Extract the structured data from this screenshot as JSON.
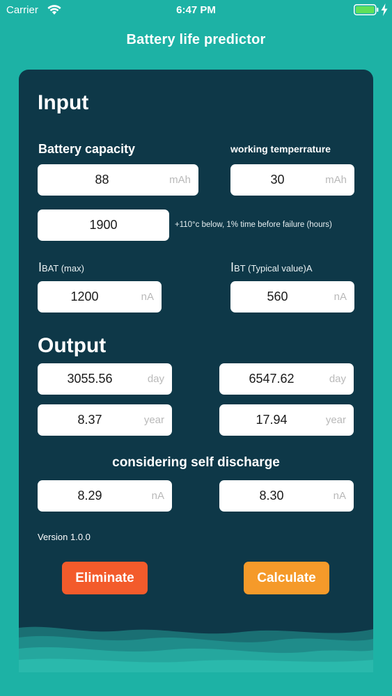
{
  "status_bar": {
    "carrier": "Carrier",
    "time": "6:47 PM"
  },
  "app": {
    "title": "Battery life predictor"
  },
  "input": {
    "heading": "Input",
    "battery_capacity_label": "Battery capacity",
    "working_temp_label": "working temperrature",
    "capacity": {
      "value": "88",
      "unit": "mAh"
    },
    "temperature": {
      "value": "30",
      "unit": "mAh"
    },
    "failure_hours": {
      "value": "1900",
      "note": "+110°c below, 1% time before failure (hours)"
    },
    "ibat_label": {
      "prefix": "I",
      "suffix": "BAT (max)"
    },
    "ibt_label": {
      "prefix": "I",
      "suffix": "BT (Typical value)A"
    },
    "ibat": {
      "value": "1200",
      "unit": "nA"
    },
    "ibt": {
      "value": "560",
      "unit": "nA"
    }
  },
  "output": {
    "heading": "Output",
    "days_left": {
      "value": "3055.56",
      "unit": "day"
    },
    "days_right": {
      "value": "6547.62",
      "unit": "day"
    },
    "years_left": {
      "value": "8.37",
      "unit": "year"
    },
    "years_right": {
      "value": "17.94",
      "unit": "year"
    },
    "self_discharge_label": "considering self discharge",
    "sd_left": {
      "value": "8.29",
      "unit": "nA"
    },
    "sd_right": {
      "value": "8.30",
      "unit": "nA"
    }
  },
  "version": "Version 1.0.0",
  "buttons": {
    "eliminate": "Eliminate",
    "calculate": "Calculate"
  },
  "colors": {
    "background": "#1db2a5",
    "card": "#0e3848",
    "eliminate": "#f35b2b",
    "calculate": "#f59a2a",
    "battery": "#5fe05a"
  }
}
